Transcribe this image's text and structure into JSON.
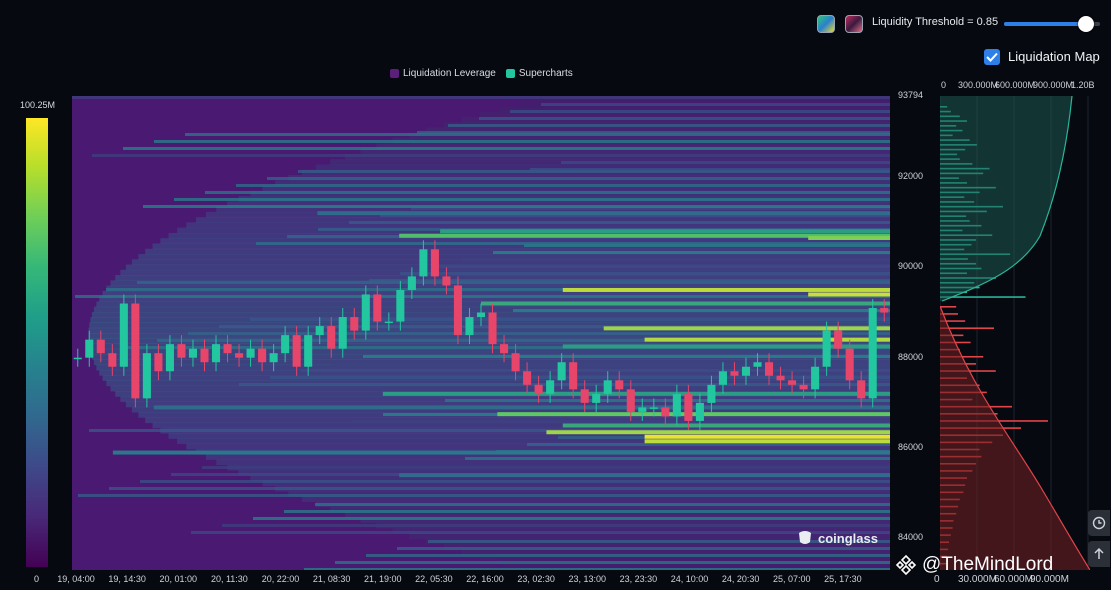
{
  "controls": {
    "threshold_label": "Liquidity Threshold = 0.85",
    "threshold_value": 0.85,
    "liquidation_map_label": "Liquidation Map",
    "liquidation_map_checked": true,
    "palette_swatches": [
      "viridis-palette",
      "red-palette"
    ]
  },
  "legend": {
    "items": [
      {
        "label": "Liquidation Leverage",
        "color": "#5a1f7a"
      },
      {
        "label": "Supercharts",
        "color": "#22c7a0"
      }
    ]
  },
  "color_scale": {
    "max_label": "100.25M",
    "min_label": "0"
  },
  "watermark": {
    "brand": "coinglass",
    "handle": "@TheMindLord"
  },
  "colors": {
    "background": "#06090f",
    "heat_low": "#440154",
    "heat_high": "#fde725",
    "candle_up": "#22c7a0",
    "candle_down": "#e8456a",
    "accent": "#2f7fe8"
  },
  "chart_data": [
    {
      "type": "heatmap",
      "title": "",
      "y_axis": {
        "range": [
          83300,
          93794
        ],
        "ticks": [
          93794,
          92000,
          90000,
          88000,
          86000,
          84000
        ],
        "tick_labels": [
          "93794",
          "92000",
          "90000",
          "88000",
          "86000",
          "84000"
        ]
      },
      "x_axis": {
        "tick_labels": [
          "19, 04:00",
          "19, 14:30",
          "20, 01:00",
          "20, 11:30",
          "20, 22:00",
          "21, 08:30",
          "21, 19:00",
          "22, 05:30",
          "22, 16:00",
          "23, 02:30",
          "23, 13:00",
          "23, 23:30",
          "24, 10:00",
          "24, 20:30",
          "25, 07:00",
          "25, 17:30"
        ]
      },
      "price_series": {
        "name": "Supercharts",
        "values": [
          88000,
          88400,
          88100,
          87800,
          89200,
          87100,
          88100,
          87700,
          88300,
          88000,
          88200,
          87900,
          88300,
          88100,
          88000,
          88200,
          87900,
          88100,
          88500,
          87800,
          88500,
          88700,
          88200,
          88900,
          88600,
          89400,
          88800,
          88800,
          89500,
          89800,
          90400,
          89800,
          89600,
          88500,
          88900,
          89000,
          88300,
          88100,
          87700,
          87400,
          87200,
          87500,
          87900,
          87300,
          87000,
          87200,
          87500,
          87300,
          86800,
          86900,
          86900,
          86700,
          87200,
          86600,
          87000,
          87400,
          87700,
          87600,
          87800,
          87900,
          87600,
          87500,
          87400,
          87300,
          87800,
          88600,
          88200,
          87500,
          87100,
          89100,
          89000
        ]
      },
      "liquidation_bands": [
        {
          "price": 91200,
          "start": 0.3,
          "intensity": 0.35
        },
        {
          "price": 90800,
          "start": 0.45,
          "intensity": 0.55
        },
        {
          "price": 90700,
          "start": 0.4,
          "intensity": 0.7
        },
        {
          "price": 90650,
          "start": 0.9,
          "intensity": 0.8
        },
        {
          "price": 89500,
          "start": 0.6,
          "intensity": 0.9
        },
        {
          "price": 89400,
          "start": 0.9,
          "intensity": 0.92
        },
        {
          "price": 89200,
          "start": 0.5,
          "intensity": 0.6
        },
        {
          "price": 88650,
          "start": 0.65,
          "intensity": 0.85
        },
        {
          "price": 88400,
          "start": 0.7,
          "intensity": 0.88
        },
        {
          "price": 88250,
          "start": 0.6,
          "intensity": 0.55
        },
        {
          "price": 87200,
          "start": 0.38,
          "intensity": 0.55
        },
        {
          "price": 86900,
          "start": 0.1,
          "intensity": 0.35
        },
        {
          "price": 86750,
          "start": 0.52,
          "intensity": 0.75
        },
        {
          "price": 86500,
          "start": 0.6,
          "intensity": 0.6
        },
        {
          "price": 86350,
          "start": 0.58,
          "intensity": 0.85
        },
        {
          "price": 86250,
          "start": 0.7,
          "intensity": 0.97
        },
        {
          "price": 86150,
          "start": 0.7,
          "intensity": 0.9
        },
        {
          "price": 85900,
          "start": 0.05,
          "intensity": 0.4
        },
        {
          "price": 85400,
          "start": 0.4,
          "intensity": 0.35
        }
      ]
    },
    {
      "type": "bar",
      "title": "",
      "orientation": "horizontal",
      "top_axis": {
        "tick_labels": [
          "0",
          "300.000M",
          "600.000M",
          "900.000M",
          "1.20B"
        ]
      },
      "bottom_axis": {
        "tick_labels": [
          "0",
          "30.000M",
          "60.000M",
          "90.000M"
        ]
      },
      "series": [
        {
          "side": "above",
          "color": "#2ab59a",
          "values": [
            8,
            12,
            22,
            30,
            18,
            25,
            14,
            33,
            41,
            28,
            19,
            22,
            36,
            55,
            48,
            21,
            30,
            62,
            44,
            27,
            38,
            70,
            52,
            29,
            33,
            46,
            25,
            58,
            40,
            35,
            27,
            78,
            31,
            40,
            46,
            30,
            62,
            38,
            44,
            30,
            95
          ]
        },
        {
          "side": "below",
          "color": "#e0454a",
          "values": [
            18,
            20,
            28,
            60,
            26,
            34,
            22,
            48,
            40,
            62,
            30,
            44,
            52,
            36,
            80,
            64,
            120,
            90,
            70,
            58,
            44,
            46,
            40,
            36,
            30,
            28,
            26,
            22,
            20,
            18,
            15,
            14,
            12,
            10,
            9,
            8,
            7
          ]
        }
      ]
    }
  ]
}
